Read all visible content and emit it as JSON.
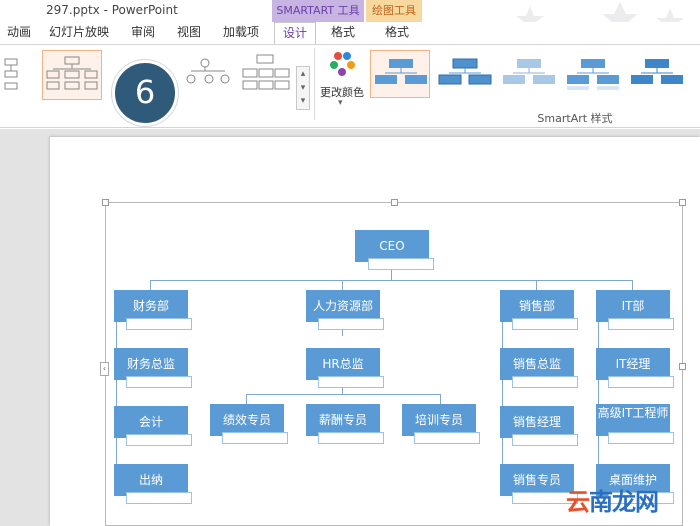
{
  "window": {
    "title": "297.pptx - PowerPoint"
  },
  "context_groups": {
    "smartart": "SMARTART 工具",
    "drawing": "绘图工具"
  },
  "tabs": [
    {
      "label": "动画"
    },
    {
      "label": "幻灯片放映"
    },
    {
      "label": "审阅"
    },
    {
      "label": "视图"
    },
    {
      "label": "加载项"
    },
    {
      "label": "设计",
      "active": true
    },
    {
      "label": "格式"
    },
    {
      "label": "格式"
    }
  ],
  "ribbon": {
    "change_colors_label": "更改颜色",
    "styles_group_label": "SmartArt 样式",
    "step_badge": "6"
  },
  "chart": {
    "root": "CEO",
    "columns": [
      {
        "head": "财务部",
        "items": [
          "财务总监",
          "会计",
          "出纳"
        ]
      },
      {
        "head": "人力资源部",
        "items": [
          "HR总监"
        ],
        "children": [
          "绩效专员",
          "薪酬专员",
          "培训专员"
        ]
      },
      {
        "head": "销售部",
        "items": [
          "销售总监",
          "销售经理",
          "销售专员"
        ]
      },
      {
        "head": "IT部",
        "items": [
          "IT经理",
          "高级IT工程师",
          "桌面维护"
        ]
      }
    ]
  },
  "watermark": {
    "first": "云",
    "rest": "南龙网"
  },
  "colors": {
    "node_fill": "#5b9bd5",
    "smartart_tab": "#c8b4e2",
    "drawing_tab": "#f7d9a0",
    "badge": "#2f5a7a"
  }
}
